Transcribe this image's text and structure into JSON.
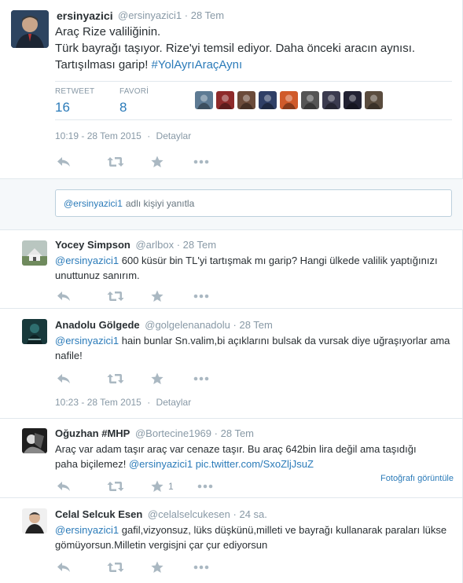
{
  "main_tweet": {
    "name": "ersinyazici",
    "handle": "@ersinyazici1",
    "time_sep": "·",
    "date": "28 Tem",
    "text_line1": "Araç Rize valiliğinin.",
    "text_line2": "Türk bayrağı taşıyor. Rize'yi temsil ediyor. Daha önceki aracın aynısı.",
    "text_line3_plain": "Tartışılması garip!",
    "text_line3_hashtag": "#YolAyrıAraçAynı",
    "retweet_label": "RETWEET",
    "retweet_count": "16",
    "favorite_label": "FAVORİ",
    "favorite_count": "8",
    "timestamp": "10:19 - 28 Tem 2015",
    "details_sep": "·",
    "details_link": "Detaylar"
  },
  "favoriters": [
    {
      "color": "#5d7a93"
    },
    {
      "color": "#8e2b2b"
    },
    {
      "color": "#6b4b3a"
    },
    {
      "color": "#2f3f66"
    },
    {
      "color": "#d05a2a"
    },
    {
      "color": "#555555"
    },
    {
      "color": "#3b3b4f"
    },
    {
      "color": "#222233"
    },
    {
      "color": "#5a4c3e"
    }
  ],
  "reply_box": {
    "mention": "@ersinyazici1",
    "placeholder_rest": "adlı kişiyi yanıtla"
  },
  "replies": [
    {
      "name": "Yocey Simpson",
      "handle": "@arlbox",
      "sep": "·",
      "date": "28 Tem",
      "mention": "@ersinyazici1",
      "text": " 600 küsür bin TL'yi tartışmak mı garip? Hangi ülkede valilik yaptığınızı unuttunuz sanırım.",
      "avatar_color": "#9aa7a0"
    },
    {
      "name": "Anadolu Gölgede",
      "handle": "@golgelenanadolu",
      "sep": "·",
      "date": "28 Tem",
      "mention": "@ersinyazici1",
      "text": " hain bunlar Sn.valim,bi açıklarını bulsak da vursak diye uğraşıyorlar ama nafile!",
      "timestamp": "10:23 - 28 Tem 2015",
      "details_sep": "·",
      "details_link": "Detaylar",
      "avatar_color": "#1d4a4c"
    },
    {
      "name": "Oğuzhan #MHP",
      "handle": "@Bortecine1969",
      "sep": "·",
      "date": "28 Tem",
      "text_line1": "Araç var adam taşır araç var cenaze taşır. Bu araç 642bin lira değil ama taşıdığı",
      "text_line2_plain": "paha biçilemez!",
      "mention": "@ersinyazici1",
      "pic_link": "pic.twitter.com/SxoZljJsuZ",
      "retweet_count": "1",
      "photo_link": "Fotoğrafı görüntüle",
      "avatar_color": "#2b2b2b"
    },
    {
      "name": "Celal Selcuk Esen",
      "handle": "@celalselcukesen",
      "sep": "·",
      "date": "24 sa.",
      "mention": "@ersinyazici1",
      "text": " gafil,vizyonsuz, lüks düşkünü,milleti ve bayrağı kullanarak paraları lükse gömüyorsun.Milletin vergisjni çar çur ediyorsun",
      "avatar_color": "#e9e9e9"
    }
  ],
  "actions": {
    "reply_icon": "reply-icon",
    "retweet_icon": "retweet-icon",
    "favorite_icon": "star-icon",
    "more_icon": "more-icon"
  }
}
